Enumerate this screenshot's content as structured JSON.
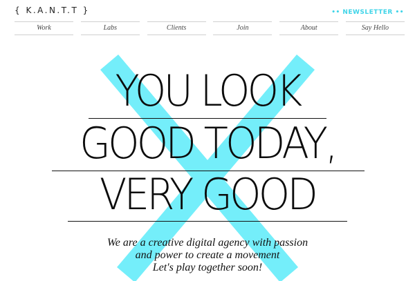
{
  "header": {
    "logo_text": "{ K.A.N.T.T }",
    "newsletter_label": "•• NEWSLETTER ••"
  },
  "nav": {
    "items": [
      {
        "label": "Work"
      },
      {
        "label": "Labs"
      },
      {
        "label": "Clients"
      },
      {
        "label": "Join"
      },
      {
        "label": "About"
      },
      {
        "label": "Say Hello"
      }
    ]
  },
  "hero": {
    "lines": [
      "YOU LOOK",
      "GOOD TODAY,",
      "VERY GOOD"
    ],
    "tagline": [
      "We are a creative digital agency with passion",
      "and power to create a movement",
      "Let's play together soon!"
    ]
  },
  "colors": {
    "accent": "#3fd4e8",
    "cross": "#74eefa",
    "text": "#0c0c0c"
  }
}
